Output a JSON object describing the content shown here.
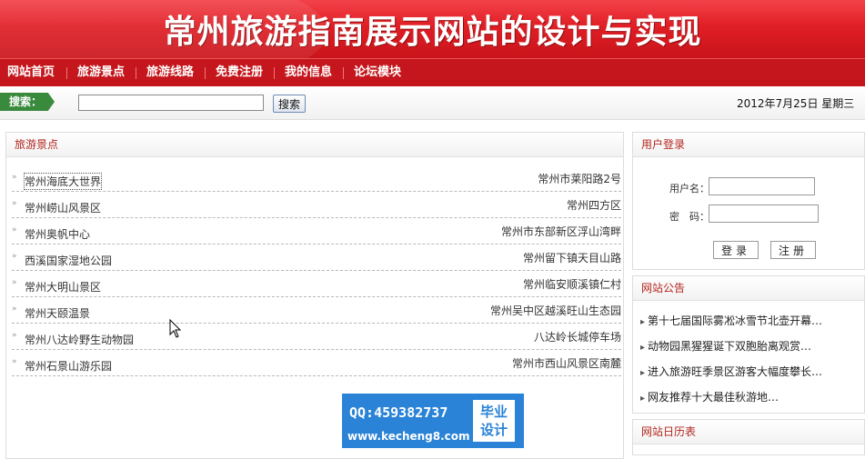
{
  "header": {
    "title": "常州旅游指南展示网站的设计与实现"
  },
  "nav": {
    "items": [
      "网站首页",
      "旅游景点",
      "旅游线路",
      "免费注册",
      "我的信息",
      "论坛模块"
    ]
  },
  "search": {
    "label": "搜索：",
    "placeholder": "",
    "value": "",
    "button": "搜索"
  },
  "date": "2012年7月25日 星期三",
  "spots": {
    "title": "旅游景点",
    "items": [
      {
        "name": "常州海底大世界",
        "address": "常州市莱阳路2号"
      },
      {
        "name": "常州崂山风景区",
        "address": "常州四方区"
      },
      {
        "name": "常州奥帆中心",
        "address": "常州市东部新区浮山湾畔"
      },
      {
        "name": "西溪国家湿地公园",
        "address": "常州留下镇天目山路"
      },
      {
        "name": "常州大明山景区",
        "address": "常州临安顺溪镇仁村"
      },
      {
        "name": "常州天颐温景",
        "address": "常州吴中区越溪旺山生态园"
      },
      {
        "name": "常州八达岭野生动物园",
        "address": "八达岭长城停车场"
      },
      {
        "name": "常州石景山游乐园",
        "address": "常州市西山风景区南麓"
      }
    ]
  },
  "login": {
    "title": "用户登录",
    "username_label": "用户名：",
    "password_label": "密　码：",
    "login_button": "登录",
    "register_button": "注册"
  },
  "notices": {
    "title": "网站公告",
    "items": [
      "第十七届国际雾凇冰雪节北壶开幕…",
      "动物园黑猩猩诞下双胞胎离观赏…",
      "进入旅游旺季景区游客大幅度攀长…",
      "网友推荐十大最佳秋游地…"
    ]
  },
  "calendar": {
    "title": "网站日历表"
  },
  "watermark": {
    "qq": "QQ:459382737",
    "url": "www.kecheng8.com",
    "badge_line1": "毕业",
    "badge_line2": "设计"
  }
}
